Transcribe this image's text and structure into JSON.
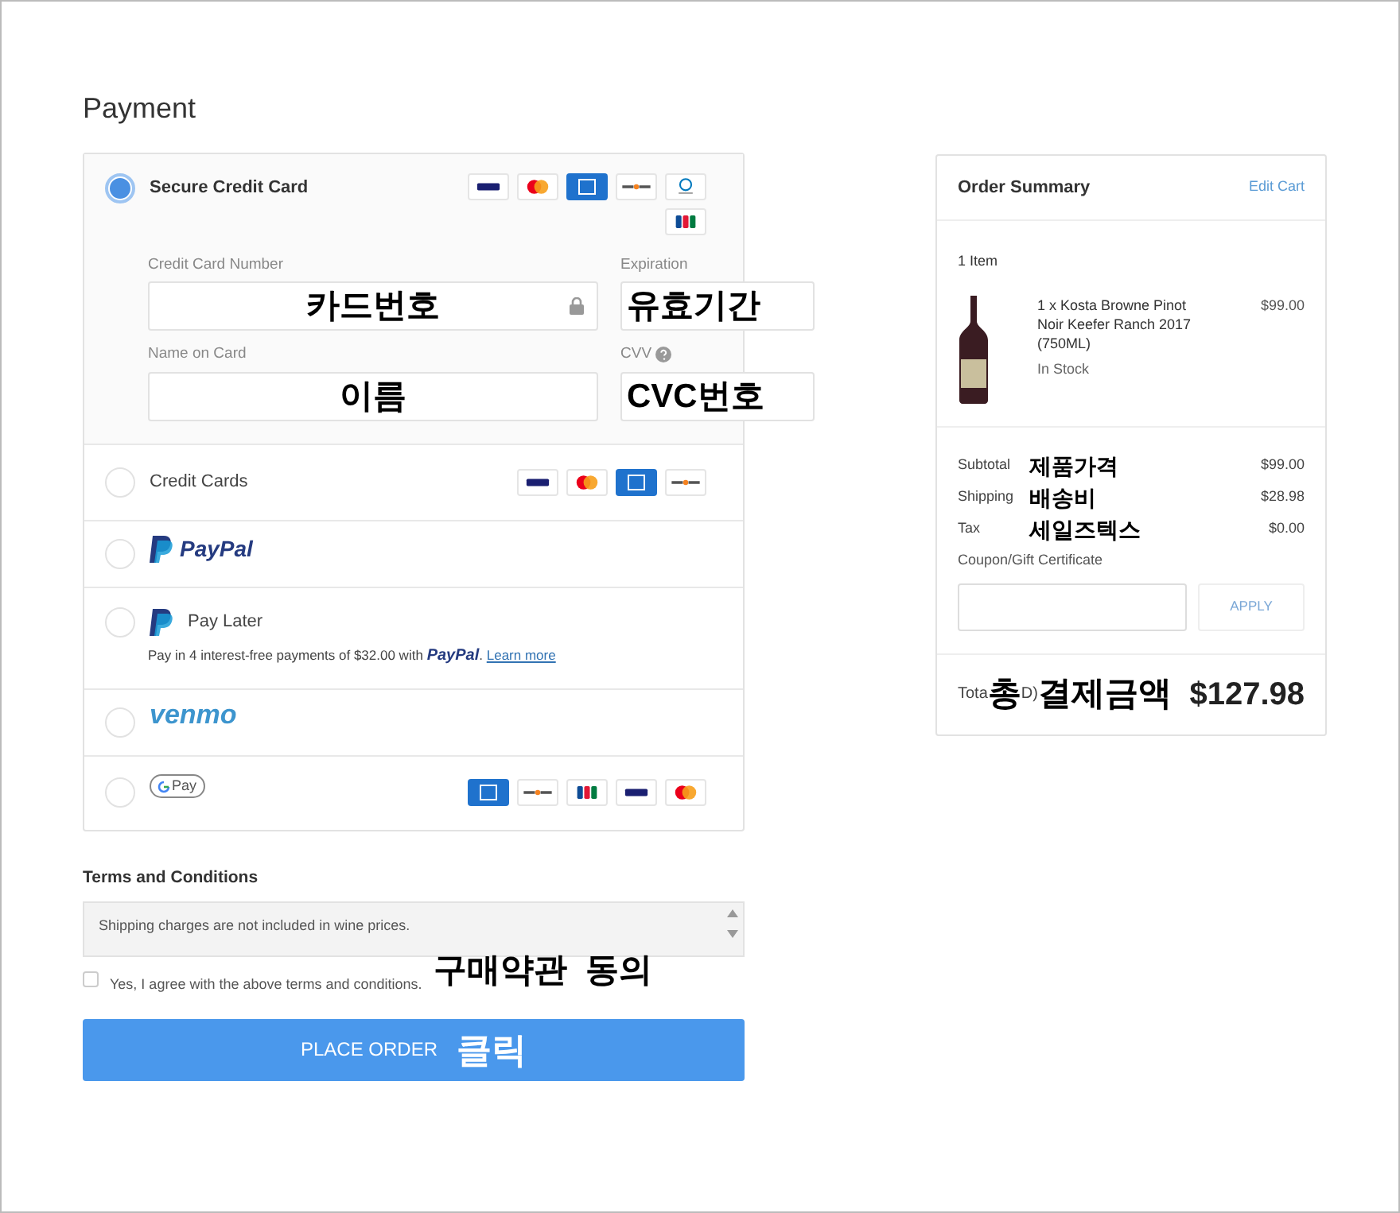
{
  "title": "Payment",
  "methods": [
    {
      "kind": "card_form",
      "label": "Secure Credit Card",
      "selected": true,
      "logos": [
        {
          "kind": "visa"
        },
        {
          "kind": "mastercard"
        },
        {
          "kind": "amex"
        },
        {
          "kind": "discover"
        },
        {
          "kind": "diners"
        },
        {
          "kind": "jcb"
        }
      ],
      "fields": [
        {
          "label": "Credit Card Number",
          "value": "카드번호",
          "lock": true
        },
        {
          "label": "Expiration",
          "value": "유효기간"
        },
        {
          "label": "Name on Card",
          "value": "이름"
        },
        {
          "label": "CVV",
          "value": "CVC번호",
          "help": true
        }
      ]
    },
    {
      "kind": "cards",
      "label": "Credit Cards",
      "selected": false,
      "logos": [
        {
          "kind": "visa"
        },
        {
          "kind": "mastercard"
        },
        {
          "kind": "amex"
        },
        {
          "kind": "discover"
        }
      ]
    },
    {
      "kind": "paypal",
      "label": "PayPal",
      "selected": false
    },
    {
      "kind": "paylater",
      "label": "Pay Later",
      "selected": false,
      "note": "Pay in 4 interest-free payments of $32.00 with",
      "brand": "PayPal",
      "punct": ".",
      "link": "Learn more"
    },
    {
      "kind": "venmo",
      "label": "venmo",
      "selected": false
    },
    {
      "kind": "gpay",
      "label": "Pay",
      "selected": false,
      "logos": [
        {
          "kind": "amex"
        },
        {
          "kind": "discover"
        },
        {
          "kind": "jcb"
        },
        {
          "kind": "visa"
        },
        {
          "kind": "mastercard"
        }
      ]
    }
  ],
  "terms": {
    "title": "Terms and Conditions",
    "text": "Shipping charges are not included in wine prices.",
    "agree_label": "Yes, I agree with the above terms and conditions.",
    "checked": false,
    "annotation": "구매약관  동의"
  },
  "place_order": {
    "label": "PLACE ORDER",
    "annotation": "클릭"
  },
  "summary": {
    "title": "Order Summary",
    "edit": "Edit Cart",
    "count": "1 Item",
    "item": {
      "name": "1 x Kosta Browne Pinot Noir Keefer Ranch 2017 (750ML)",
      "stock": "In Stock",
      "price": "$99.00"
    },
    "lines": [
      {
        "label": "Subtotal",
        "note": "제품가격",
        "value": "$99.00"
      },
      {
        "label": "Shipping",
        "note": "배송비",
        "value": "$28.98"
      },
      {
        "label": "Tax",
        "note": "세일즈텍스",
        "value": "$0.00"
      }
    ],
    "coupon_label": "Coupon/Gift Certificate",
    "apply": "APPLY",
    "total": {
      "label_start": "Tota",
      "mark": "총",
      "label_end": "D)",
      "note": "결제금액",
      "value": "$127.98"
    }
  }
}
